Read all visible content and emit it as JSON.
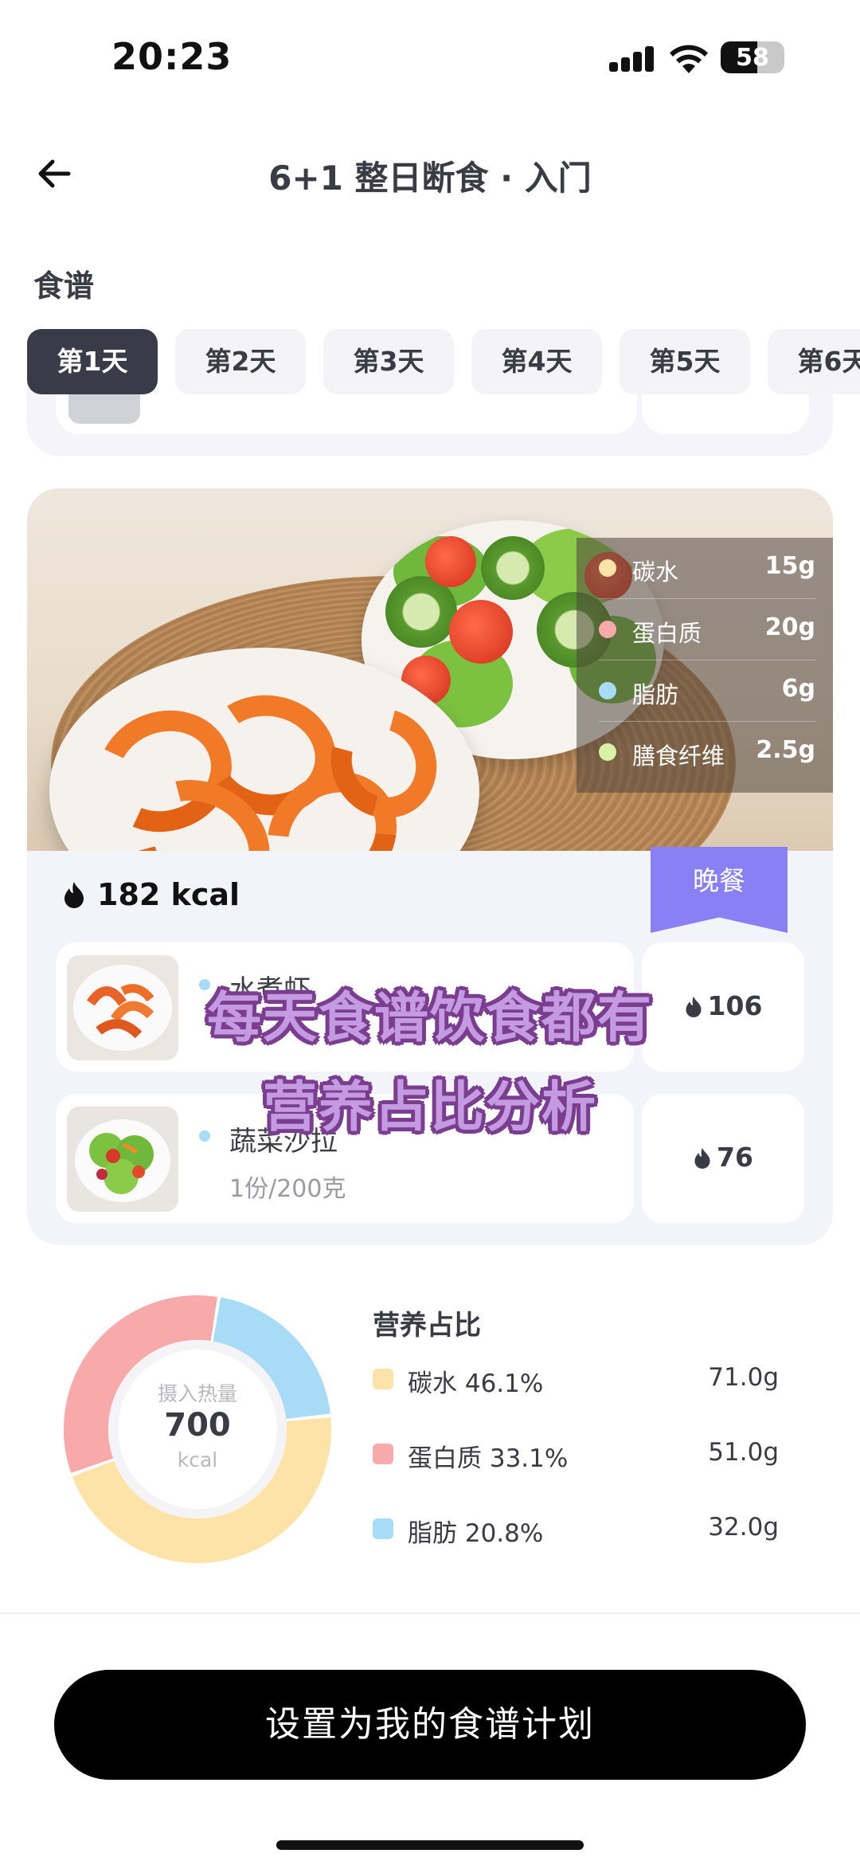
{
  "status_bar": {
    "time": "20:23",
    "battery": "58"
  },
  "header": {
    "title": "6+1 整日断食 · 入门"
  },
  "section": {
    "label": "食谱"
  },
  "day_tabs": [
    {
      "label": "第1天",
      "active": true
    },
    {
      "label": "第2天",
      "active": false
    },
    {
      "label": "第3天",
      "active": false
    },
    {
      "label": "第4天",
      "active": false
    },
    {
      "label": "第5天",
      "active": false
    },
    {
      "label": "第6天",
      "active": false
    }
  ],
  "meal": {
    "tag": "晚餐",
    "kcal": "182 kcal",
    "nutrients": [
      {
        "name": "碳水",
        "value": "15g",
        "color": "#fde3a7"
      },
      {
        "name": "蛋白质",
        "value": "20g",
        "color": "#f8a9a9"
      },
      {
        "name": "脂肪",
        "value": "6g",
        "color": "#a8dcf6"
      },
      {
        "name": "膳食纤维",
        "value": "2.5g",
        "color": "#d8f3a4"
      }
    ],
    "foods": [
      {
        "name": "水煮虾",
        "portion": "",
        "kcal": "106"
      },
      {
        "name": "蔬菜沙拉",
        "portion": "1份/200克",
        "kcal": "76"
      }
    ]
  },
  "overlay": {
    "line1": "每天食谱饮食都有",
    "line2": "营养占比分析"
  },
  "summary": {
    "donut_label": "摄入热量",
    "donut_value": "700",
    "donut_unit": "kcal",
    "title": "营养占比",
    "items": [
      {
        "name": "碳水 46.1%",
        "value": "71.0g",
        "percent": 46.1,
        "color": "#fde3a7"
      },
      {
        "name": "蛋白质 33.1%",
        "value": "51.0g",
        "percent": 33.1,
        "color": "#f8a9a9"
      },
      {
        "name": "脂肪 20.8%",
        "value": "32.0g",
        "percent": 20.8,
        "color": "#a8dcf6"
      }
    ]
  },
  "cta": {
    "label": "设置为我的食谱计划"
  }
}
